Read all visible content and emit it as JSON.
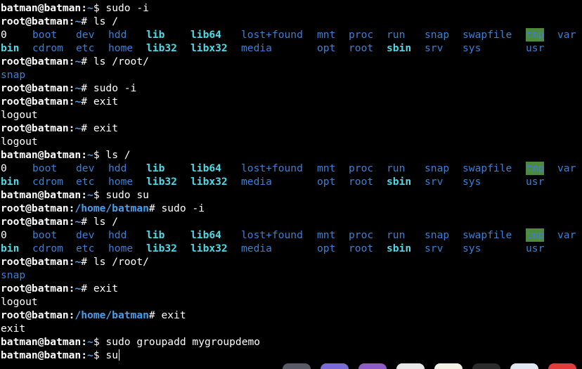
{
  "prompts": {
    "user": "batman@batman",
    "root_home": "root@batman",
    "user_sym": "$",
    "root_sym": "#"
  },
  "lines": [
    {
      "type": "prompt",
      "user": "batman@batman",
      "path": "~",
      "sym": "$",
      "cmd": "sudo -i"
    },
    {
      "type": "prompt",
      "user": "root@batman",
      "path": "~",
      "sym": "#",
      "cmd": "ls /"
    },
    {
      "type": "ls",
      "row": 0
    },
    {
      "type": "ls",
      "row": 1
    },
    {
      "type": "prompt",
      "user": "root@batman",
      "path": "~",
      "sym": "#",
      "cmd": "ls /root/"
    },
    {
      "type": "out",
      "text": "snap",
      "cls": "c-dir"
    },
    {
      "type": "prompt",
      "user": "root@batman",
      "path": "~",
      "sym": "#",
      "cmd": "sudo -i"
    },
    {
      "type": "prompt",
      "user": "root@batman",
      "path": "~",
      "sym": "#",
      "cmd": "exit"
    },
    {
      "type": "out",
      "text": "logout"
    },
    {
      "type": "prompt",
      "user": "root@batman",
      "path": "~",
      "sym": "#",
      "cmd": "exit"
    },
    {
      "type": "out",
      "text": "logout"
    },
    {
      "type": "prompt",
      "user": "batman@batman",
      "path": "~",
      "sym": "$",
      "cmd": "ls /"
    },
    {
      "type": "ls",
      "row": 0
    },
    {
      "type": "ls",
      "row": 1
    },
    {
      "type": "prompt",
      "user": "batman@batman",
      "path": "~",
      "sym": "$",
      "cmd": "sudo su"
    },
    {
      "type": "prompt",
      "user": "root@batman",
      "path": "/home/batman",
      "sym": "#",
      "cmd": "sudo -i"
    },
    {
      "type": "prompt",
      "user": "root@batman",
      "path": "~",
      "sym": "#",
      "cmd": "ls /"
    },
    {
      "type": "ls",
      "row": 0
    },
    {
      "type": "ls",
      "row": 1
    },
    {
      "type": "prompt",
      "user": "root@batman",
      "path": "~",
      "sym": "#",
      "cmd": "ls /root/"
    },
    {
      "type": "out",
      "text": "snap",
      "cls": "c-dir"
    },
    {
      "type": "prompt",
      "user": "root@batman",
      "path": "~",
      "sym": "#",
      "cmd": "exit"
    },
    {
      "type": "out",
      "text": "logout"
    },
    {
      "type": "prompt",
      "user": "root@batman",
      "path": "/home/batman",
      "sym": "#",
      "cmd": "exit"
    },
    {
      "type": "out",
      "text": "exit"
    },
    {
      "type": "prompt",
      "user": "batman@batman",
      "path": "~",
      "sym": "$",
      "cmd": "sudo groupadd mygroupdemo"
    },
    {
      "type": "prompt",
      "user": "batman@batman",
      "path": "~",
      "sym": "$",
      "cmd": "su",
      "cursor": true
    }
  ],
  "ls_rows": [
    [
      {
        "text": "0",
        "cls": ""
      },
      {
        "text": "boot",
        "cls": "c-dir"
      },
      {
        "text": "dev",
        "cls": "c-dir"
      },
      {
        "text": "hdd",
        "cls": "c-dir"
      },
      {
        "text": "lib",
        "cls": "c-link"
      },
      {
        "text": "lib64",
        "cls": "c-link"
      },
      {
        "text": "lost+found",
        "cls": "c-dir"
      },
      {
        "text": "mnt",
        "cls": "c-dir"
      },
      {
        "text": "proc",
        "cls": "c-dir"
      },
      {
        "text": "run",
        "cls": "c-dir"
      },
      {
        "text": "snap",
        "cls": "c-dir"
      },
      {
        "text": "swapfile",
        "cls": "c-dir"
      },
      {
        "text": "tmp",
        "cls": "c-tmp"
      },
      {
        "text": "var",
        "cls": "c-dir"
      }
    ],
    [
      {
        "text": "bin",
        "cls": "c-link"
      },
      {
        "text": "cdrom",
        "cls": "c-dir"
      },
      {
        "text": "etc",
        "cls": "c-dir"
      },
      {
        "text": "home",
        "cls": "c-dir"
      },
      {
        "text": "lib32",
        "cls": "c-link"
      },
      {
        "text": "libx32",
        "cls": "c-link"
      },
      {
        "text": "media",
        "cls": "c-dir"
      },
      {
        "text": "opt",
        "cls": "c-dir"
      },
      {
        "text": "root",
        "cls": "c-dir"
      },
      {
        "text": "sbin",
        "cls": "c-link"
      },
      {
        "text": "srv",
        "cls": "c-dir"
      },
      {
        "text": "sys",
        "cls": "c-dir"
      },
      {
        "text": "usr",
        "cls": "c-dir"
      }
    ]
  ],
  "colors": {
    "background": "#000000",
    "text": "#ffffff",
    "path": "#4a9ee6",
    "directory": "#3d7fd0",
    "symlink": "#4ed9e6",
    "sticky_bg": "#4e8a3e"
  },
  "dock": [
    {
      "icon": "dock-app-icon-1",
      "color": "#5a5a66"
    },
    {
      "icon": "dock-app-icon-2",
      "color": "#7a6ad8"
    },
    {
      "icon": "dock-app-icon-3",
      "color": "#8d5cc9"
    },
    {
      "icon": "dock-app-icon-4",
      "color": "#e8e8e8"
    },
    {
      "icon": "dock-app-icon-5",
      "color": "#f3f0e6"
    },
    {
      "icon": "dock-app-icon-6",
      "color": "#2b2b2b"
    },
    {
      "icon": "dock-app-icon-7",
      "color": "#dfe8f0"
    },
    {
      "icon": "dock-app-icon-8",
      "color": "#e23b3b"
    }
  ]
}
